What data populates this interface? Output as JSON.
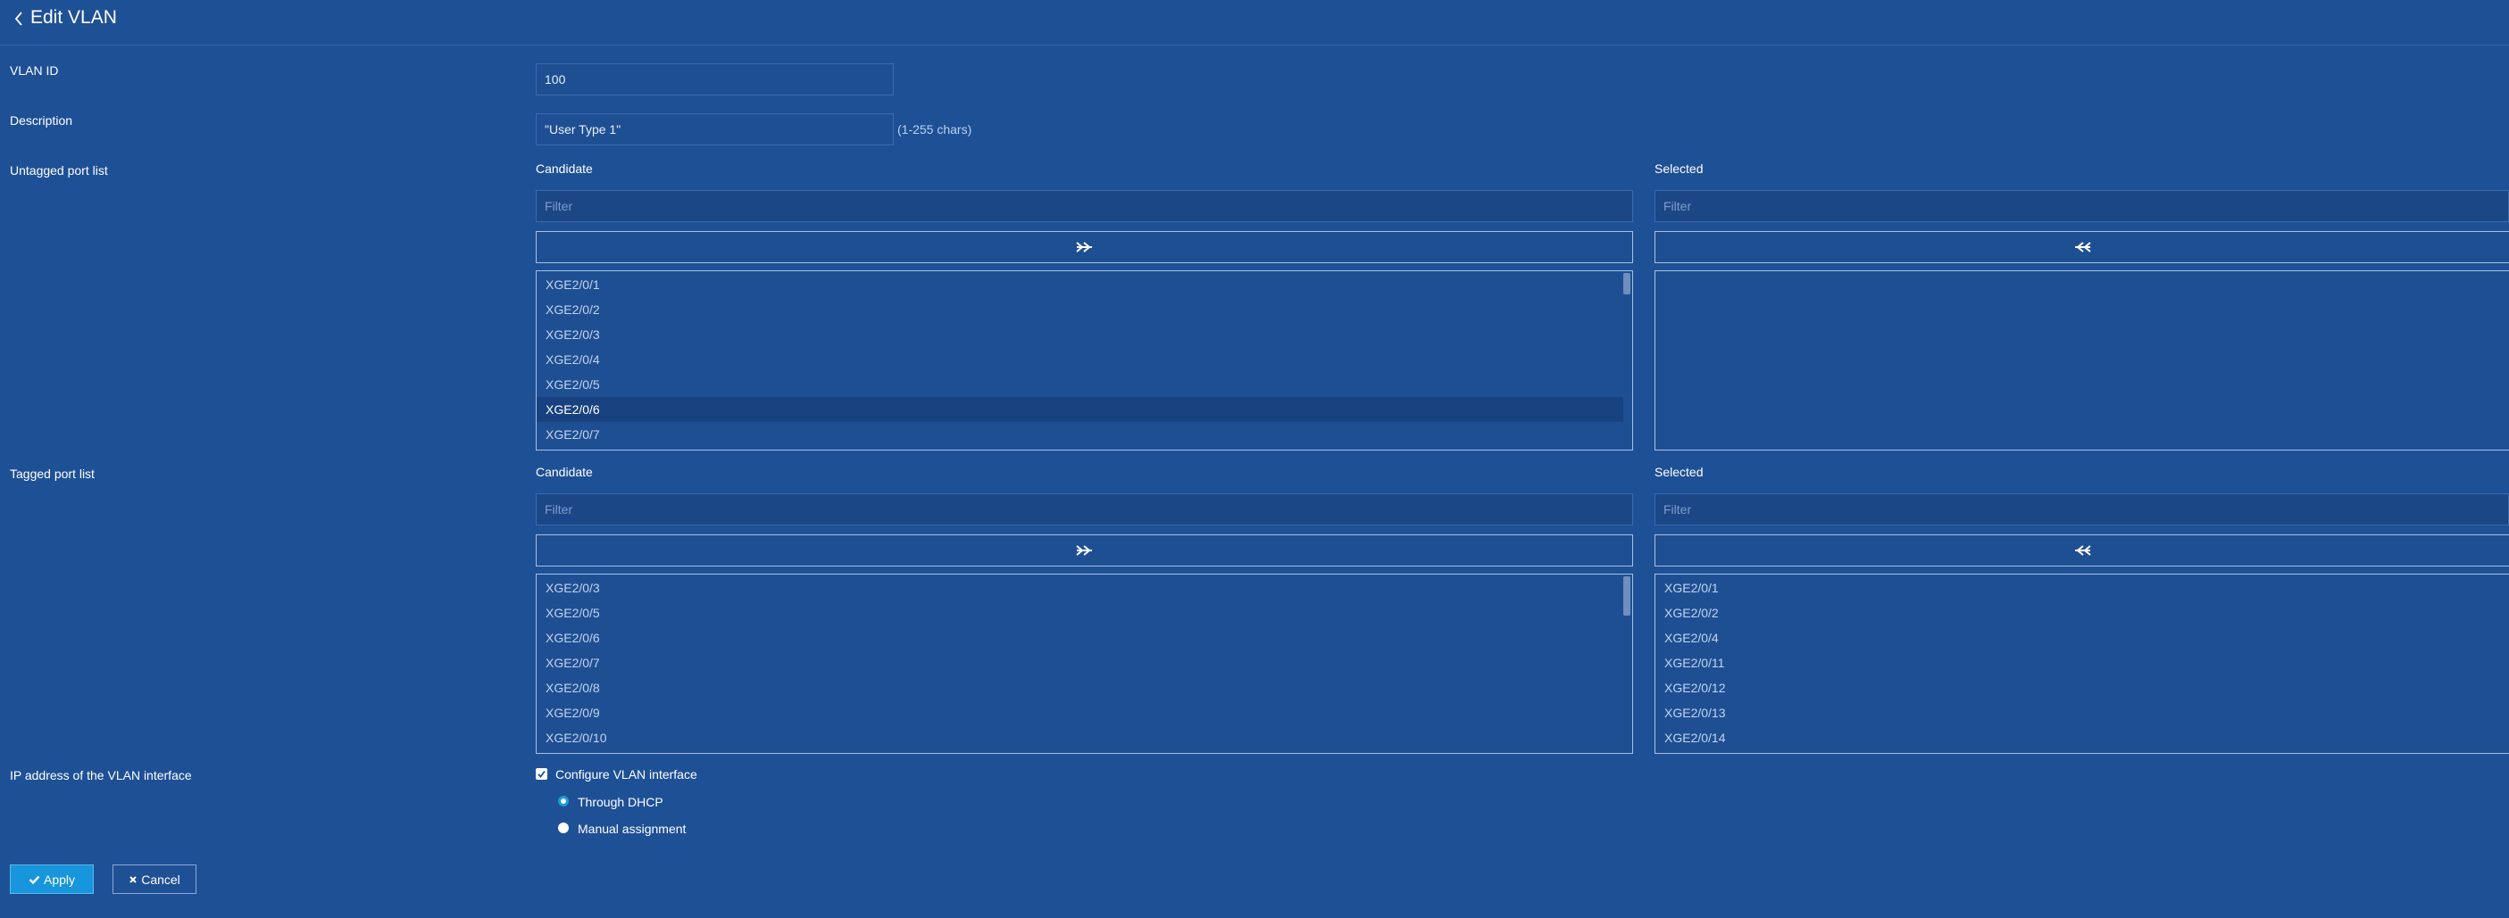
{
  "header": {
    "title": "Edit VLAN"
  },
  "form": {
    "vlan_id": {
      "label": "VLAN ID",
      "value": "100"
    },
    "description": {
      "label": "Description",
      "value": "\"User Type 1\"",
      "hint": "(1-255 chars)"
    },
    "untagged": {
      "label": "Untagged port list",
      "candidate": {
        "heading": "Candidate",
        "filter_placeholder": "Filter",
        "items": [
          "XGE2/0/1",
          "XGE2/0/2",
          "XGE2/0/3",
          "XGE2/0/4",
          "XGE2/0/5",
          "XGE2/0/6",
          "XGE2/0/7"
        ],
        "highlighted": "XGE2/0/6"
      },
      "selected": {
        "heading": "Selected",
        "filter_placeholder": "Filter",
        "items": []
      }
    },
    "tagged": {
      "label": "Tagged port list",
      "candidate": {
        "heading": "Candidate",
        "filter_placeholder": "Filter",
        "items": [
          "XGE2/0/3",
          "XGE2/0/5",
          "XGE2/0/6",
          "XGE2/0/7",
          "XGE2/0/8",
          "XGE2/0/9",
          "XGE2/0/10"
        ]
      },
      "selected": {
        "heading": "Selected",
        "filter_placeholder": "Filter",
        "items": [
          "XGE2/0/1",
          "XGE2/0/2",
          "XGE2/0/4",
          "XGE2/0/11",
          "XGE2/0/12",
          "XGE2/0/13",
          "XGE2/0/14"
        ]
      }
    },
    "ip": {
      "label": "IP address of the VLAN interface",
      "configure_label": "Configure VLAN interface",
      "configure_checked": true,
      "options": [
        "Through DHCP",
        "Manual assignment"
      ],
      "selected_option": "Through DHCP"
    }
  },
  "buttons": {
    "apply": "Apply",
    "cancel": "Cancel"
  },
  "colors": {
    "background": "#1e5096",
    "accent": "#1795dd"
  }
}
